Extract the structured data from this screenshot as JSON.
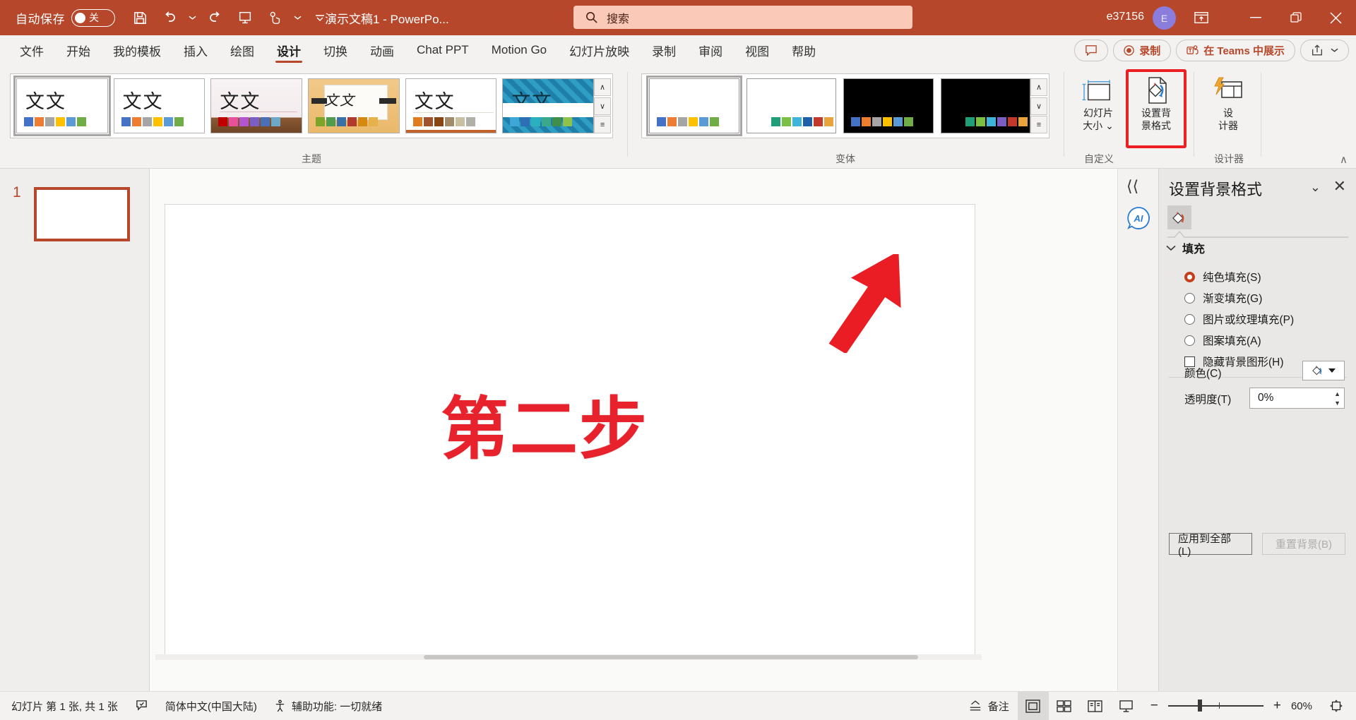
{
  "titlebar": {
    "autosave_label": "自动保存",
    "autosave_state": "关",
    "doc_title": "演示文稿1  -  PowerPo...",
    "search_placeholder": "搜索",
    "user_name": "e37156",
    "avatar_initial": "E",
    "qat": [
      {
        "name": "save-icon",
        "label": "保存"
      },
      {
        "name": "undo-icon",
        "label": "撤消"
      },
      {
        "name": "undo-dropdown-icon",
        "label": "撤消下拉"
      },
      {
        "name": "redo-icon",
        "label": "恢复"
      },
      {
        "name": "start-slideshow-icon",
        "label": "从头开始"
      },
      {
        "name": "touch-mode-icon",
        "label": "触摸/鼠标模式"
      },
      {
        "name": "touch-dropdown-icon",
        "label": "触摸模式下拉"
      },
      {
        "name": "customize-qat-icon",
        "label": "自定义快速访问工具栏"
      }
    ],
    "window_buttons": [
      {
        "name": "ribbon-display-options-icon",
        "label": "功能区显示选项"
      },
      {
        "name": "minimize-icon",
        "label": "最小化"
      },
      {
        "name": "restore-icon",
        "label": "向下还原"
      },
      {
        "name": "close-icon",
        "label": "关闭"
      }
    ]
  },
  "tabs": [
    {
      "label": "文件",
      "active": false
    },
    {
      "label": "开始",
      "active": false
    },
    {
      "label": "我的模板",
      "active": false
    },
    {
      "label": "插入",
      "active": false
    },
    {
      "label": "绘图",
      "active": false
    },
    {
      "label": "设计",
      "active": true
    },
    {
      "label": "切换",
      "active": false
    },
    {
      "label": "动画",
      "active": false
    },
    {
      "label": "Chat PPT",
      "active": false
    },
    {
      "label": "Motion Go",
      "active": false
    },
    {
      "label": "幻灯片放映",
      "active": false
    },
    {
      "label": "录制",
      "active": false
    },
    {
      "label": "审阅",
      "active": false
    },
    {
      "label": "视图",
      "active": false
    },
    {
      "label": "帮助",
      "active": false
    }
  ],
  "tab_actions": {
    "comments_label": "批注",
    "record_label": "录制",
    "teams_label": "在 Teams 中展示",
    "share_label": "共享"
  },
  "ribbon": {
    "groups": [
      {
        "label": "主题"
      },
      {
        "label": "变体"
      },
      {
        "label": "自定义"
      },
      {
        "label": "设计器"
      }
    ],
    "theme_thumbs": [
      {
        "text": "文文",
        "selected": true,
        "style": "plain",
        "colors": [
          "#4472c4",
          "#ed7d31",
          "#a5a5a5",
          "#ffc000",
          "#5b9bd5",
          "#70ad47"
        ]
      },
      {
        "text": "文文",
        "selected": false,
        "style": "plain",
        "colors": [
          "#4472c4",
          "#ed7d31",
          "#a5a5a5",
          "#ffc000",
          "#5b9bd5",
          "#70ad47"
        ]
      },
      {
        "text": "文文",
        "selected": false,
        "style": "wood",
        "colors": [
          "#c00000",
          "#e8509a",
          "#b455d0",
          "#7b5ec4",
          "#4a6fb5",
          "#6fa8c7"
        ]
      },
      {
        "text": "文文",
        "selected": false,
        "style": "banded",
        "colors": [
          "#7ba428",
          "#4f9b4f",
          "#3b6fa8",
          "#b03a2e",
          "#d68910",
          "#e8b04b"
        ]
      },
      {
        "text": "文文",
        "selected": false,
        "style": "facet",
        "colors": [
          "#e07b20",
          "#a0522d",
          "#8b4513",
          "#a08b6a",
          "#c8c0a0",
          "#b0b0a8"
        ]
      },
      {
        "text": "文文",
        "selected": false,
        "style": "pattern",
        "colors": [
          "#3da8d8",
          "#2d6fb5",
          "#2bb0c0",
          "#3aa88b",
          "#3f8f4a",
          "#8fc24a"
        ]
      }
    ],
    "variant_thumbs": [
      {
        "selected": true,
        "bg": "#ffffff",
        "colors": [
          "#4472c4",
          "#ed7d31",
          "#a5a5a5",
          "#ffc000",
          "#5b9bd5",
          "#70ad47"
        ]
      },
      {
        "selected": false,
        "bg": "#ffffff",
        "colors": [
          "#1f9e78",
          "#7cc043",
          "#3fb4d8",
          "#1f5fa8",
          "#c0392b",
          "#e8a33d"
        ]
      },
      {
        "selected": false,
        "bg": "#000000",
        "colors": [
          "#4472c4",
          "#ed7d31",
          "#a5a5a5",
          "#ffc000",
          "#5b9bd5",
          "#70ad47"
        ]
      },
      {
        "selected": false,
        "bg": "#000000",
        "colors": [
          "#1f9e78",
          "#7cc043",
          "#3fb4d8",
          "#7b5ec4",
          "#c0392b",
          "#e8a33d"
        ]
      }
    ],
    "buttons": [
      {
        "name": "slide-size-button",
        "line1": "幻灯片",
        "line2": "大小 ⌄",
        "icon": "slide-size-icon",
        "highlighted": false
      },
      {
        "name": "format-background-button",
        "line1": "设置背",
        "line2": "景格式",
        "icon": "format-background-icon",
        "highlighted": true
      },
      {
        "name": "designer-button",
        "line1": "设",
        "line2": "计器",
        "icon": "designer-icon",
        "highlighted": false
      }
    ],
    "collapse_label": "∧"
  },
  "slides": {
    "thumbnails": [
      {
        "number": "1"
      }
    ]
  },
  "slide_content": {
    "text": "第二步",
    "text_color": "#e8222c",
    "arrow_color": "#ea1c24",
    "arrow_name": "red-arrow-shape"
  },
  "rail": {
    "collapse_icon_label": "⟨⟨",
    "copilot_label": "AI"
  },
  "pane": {
    "title": "设置背景格式",
    "tab_icon": "fill-bucket-icon",
    "chevron_label": "⌄",
    "close_label": "✕",
    "section": "填充",
    "options": [
      {
        "label": "纯色填充(S)",
        "type": "radio",
        "selected": true,
        "name": "solid-fill-radio"
      },
      {
        "label": "渐变填充(G)",
        "type": "radio",
        "selected": false,
        "name": "gradient-fill-radio"
      },
      {
        "label": "图片或纹理填充(P)",
        "type": "radio",
        "selected": false,
        "name": "picture-texture-fill-radio"
      },
      {
        "label": "图案填充(A)",
        "type": "radio",
        "selected": false,
        "name": "pattern-fill-radio"
      },
      {
        "label": "隐藏背景图形(H)",
        "type": "checkbox",
        "selected": false,
        "name": "hide-background-graphics-checkbox"
      }
    ],
    "color_label": "颜色(C)",
    "transparency_label": "透明度(T)",
    "transparency_value": "0%",
    "apply_all_label": "应用到全部(L)",
    "reset_label": "重置背景(B)"
  },
  "statusbar": {
    "slide_info": "幻灯片 第 1 张, 共 1 张",
    "language": "简体中文(中国大陆)",
    "accessibility": "辅助功能: 一切就绪",
    "notes_label": "备注",
    "zoom_level": "60%",
    "zoom_minus": "−",
    "zoom_plus": "+",
    "views": [
      {
        "name": "view-normal",
        "active": true
      },
      {
        "name": "view-slide-sorter",
        "active": false
      },
      {
        "name": "view-reading",
        "active": false
      },
      {
        "name": "view-slideshow",
        "active": false
      }
    ]
  },
  "colors": {
    "brand": "#b7472a",
    "search_bg": "#fbc9b8",
    "highlight": "#ec2024",
    "accent_red": "#e8222c"
  }
}
